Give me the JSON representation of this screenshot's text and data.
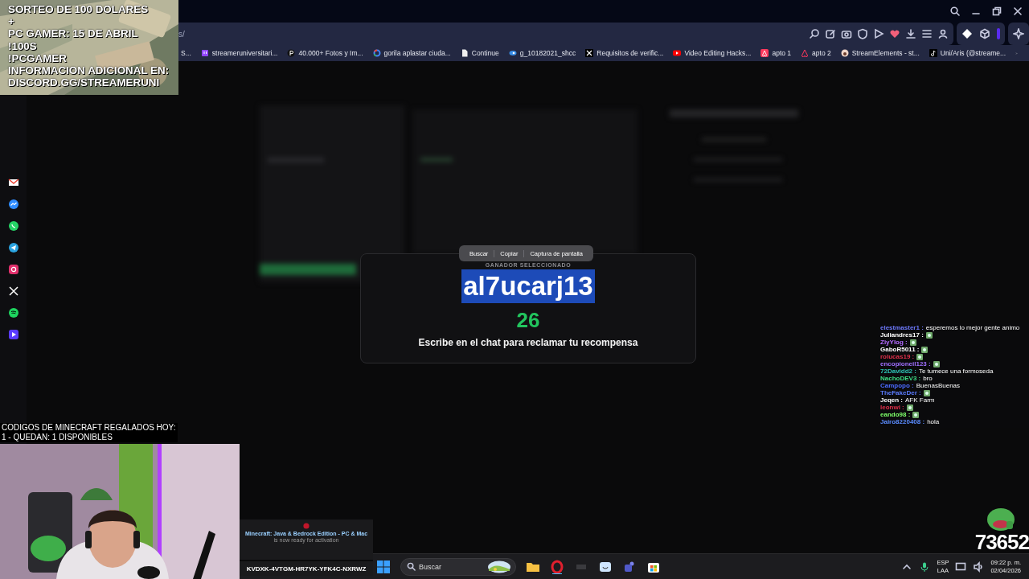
{
  "stream_overlay": {
    "giveaway_lines": [
      "SORTEO DE 100 DOLARES",
      "+",
      "PC GAMER: 15 DE ABRIL",
      "!100S",
      "!PCGAMER",
      "INFORMACION ADICIONAL EN:",
      "DISCORD.GG/STREAMERUNI"
    ],
    "minecraft_codes": [
      "CODIGOS DE MINECRAFT REGALADOS HOY:",
      "1 - QUEDAN: 1 DISPONIBLES"
    ],
    "code_card": {
      "title": "Minecraft: Java & Bedrock Edition - PC & Mac",
      "subtitle": "is now ready for activation",
      "code": "KVDXK-4VTGM-HR7YK-YFK4C-NXRWZ"
    },
    "counter": "73652"
  },
  "browser": {
    "address": "s/",
    "bookmarks": [
      {
        "label": "S...",
        "kind": "none"
      },
      {
        "label": "streameruniversitari...",
        "kind": "twitch"
      },
      {
        "label": "40.000+ Fotos y Im...",
        "kind": "pexels"
      },
      {
        "label": "gorila aplastar ciuda...",
        "kind": "google"
      },
      {
        "label": "Continue",
        "kind": "page"
      },
      {
        "label": "g_10182021_shcc",
        "kind": "round"
      },
      {
        "label": "Requisitos de verific...",
        "kind": "x"
      },
      {
        "label": "Video Editing Hacks...",
        "kind": "youtube"
      },
      {
        "label": "apto 1",
        "kind": "airbnb"
      },
      {
        "label": "apto 2",
        "kind": "airbnb-outline"
      },
      {
        "label": "StreamElements - st...",
        "kind": "streamelements"
      },
      {
        "label": "Uni/Aris (@streame...",
        "kind": "tiktok"
      }
    ]
  },
  "modal": {
    "context_menu": [
      "Buscar",
      "Copiar",
      "Captura de pantalla"
    ],
    "heading": "GANADOR SELECCIONADO",
    "winner": "al7ucarj13",
    "winner_selected": true,
    "count": "26",
    "message": "Escribe en el chat para reclamar tu recompensa"
  },
  "chat": [
    {
      "user": "elestmaster1 :",
      "message": "esperemos lo mejor gente animo",
      "kind": "text",
      "color": "#6f7bff"
    },
    {
      "user": "Juliandres17 :",
      "kind": "emote",
      "color": "#ffffff"
    },
    {
      "user": "ZiyYlog :",
      "kind": "emote",
      "color": "#b36bff"
    },
    {
      "user": "GaboR5011 :",
      "kind": "emote",
      "color": "#ffffff"
    },
    {
      "user": "rolucas19 :",
      "kind": "emote",
      "color": "#e0304a"
    },
    {
      "user": "encopioneil123 :",
      "kind": "emote",
      "color": "#a070ff"
    },
    {
      "user": "72Davidd2 :",
      "message": "Te tumece una formoseda",
      "kind": "text",
      "color": "#2ec4b6"
    },
    {
      "user": "NachoDEV3 :",
      "message": "bro",
      "kind": "text",
      "color": "#3ddc84"
    },
    {
      "user": "Campopo :",
      "message": "BuenasBuenas",
      "kind": "text",
      "color": "#4b6bff"
    },
    {
      "user": "TheFakeDer :",
      "kind": "emote",
      "color": "#5b7cff"
    },
    {
      "user": "Jeqen :",
      "message": "AFK Farm",
      "kind": "text",
      "color": "#ffffff"
    },
    {
      "user": "leonwi :",
      "kind": "emote",
      "color": "#e0304a"
    },
    {
      "user": "eando98 :",
      "kind": "emote",
      "color": "#7dff6a"
    },
    {
      "user": "Jairo8220408 :",
      "message": "hola",
      "kind": "text",
      "color": "#5b8cff"
    }
  ],
  "taskbar": {
    "search_placeholder": "Buscar",
    "language": "ESP",
    "layout": "LAA",
    "time": "09:22 p. m.",
    "date": "02/04/2026"
  }
}
